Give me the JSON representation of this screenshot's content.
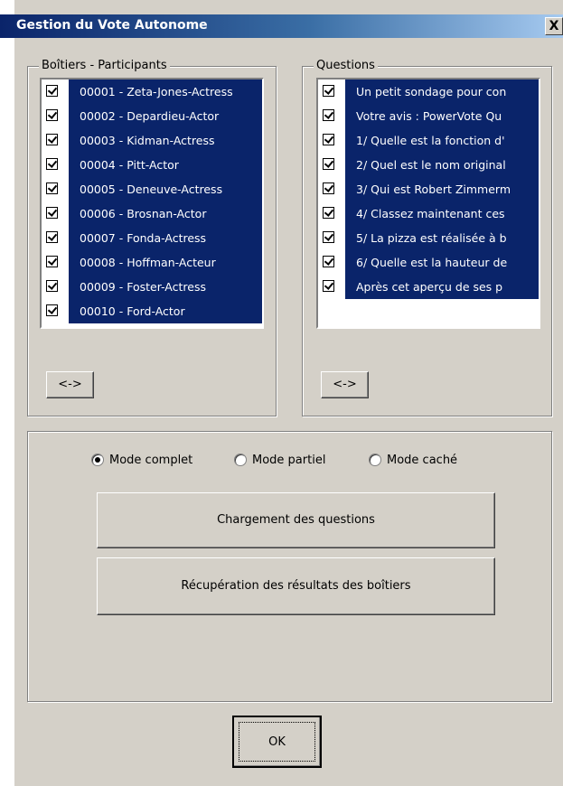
{
  "window": {
    "title": "Gestion du Vote Autonome",
    "close_symbol": "X"
  },
  "participants": {
    "label": "Boîtiers - Participants",
    "items": [
      "00001 - Zeta-Jones-Actress",
      "00002 - Depardieu-Actor",
      "00003 - Kidman-Actress",
      "00004 - Pitt-Actor",
      "00005 - Deneuve-Actress",
      "00006 - Brosnan-Actor",
      "00007 - Fonda-Actress",
      "00008 - Hoffman-Acteur",
      "00009 - Foster-Actress",
      "00010 - Ford-Actor"
    ],
    "swap_label": "<->"
  },
  "questions": {
    "label": "Questions",
    "items": [
      "Un petit sondage pour con",
      "Votre avis : PowerVote Qu",
      "1/ Quelle est la fonction d'",
      "2/ Quel est le nom original",
      "3/ Qui est Robert Zimmerm",
      "4/ Classez maintenant ces",
      "5/ La pizza est réalisée à b",
      "6/ Quelle est la hauteur de",
      "Après cet aperçu de ses p"
    ],
    "swap_label": "<->"
  },
  "modes": [
    {
      "label": "Mode complet",
      "selected": true
    },
    {
      "label": "Mode partiel",
      "selected": false
    },
    {
      "label": "Mode caché",
      "selected": false
    }
  ],
  "actions": {
    "load_label": "Chargement des questions",
    "fetch_label": "Récupération des résultats des boîtiers"
  },
  "ok_label": "OK"
}
